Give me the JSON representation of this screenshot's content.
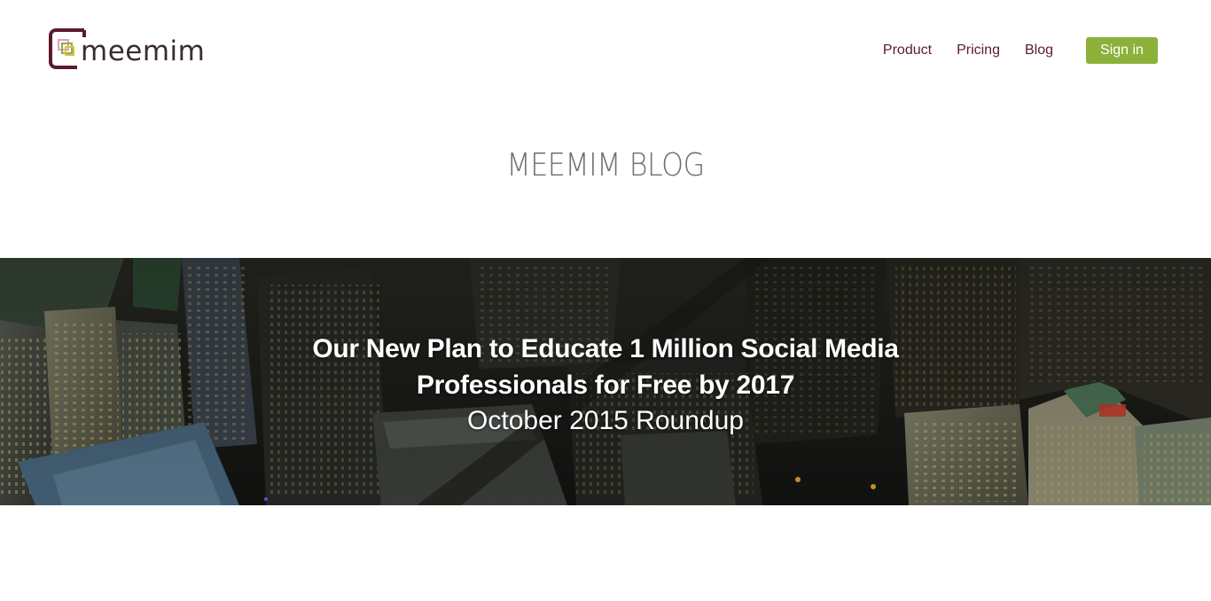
{
  "brand": {
    "name": "meemim",
    "colors": {
      "primary": "#5b1a2c",
      "accent": "#8bb13a"
    }
  },
  "nav": {
    "items": [
      {
        "label": "Product"
      },
      {
        "label": "Pricing"
      },
      {
        "label": "Blog"
      }
    ],
    "signin_label": "Sign in"
  },
  "page": {
    "title": "MEEMIM BLOG"
  },
  "hero": {
    "heading": "Our New Plan to Educate 1 Million Social Media Professionals for Free by 2017",
    "subheading": "October 2015 Roundup",
    "image": "city-night-aerial-image"
  }
}
